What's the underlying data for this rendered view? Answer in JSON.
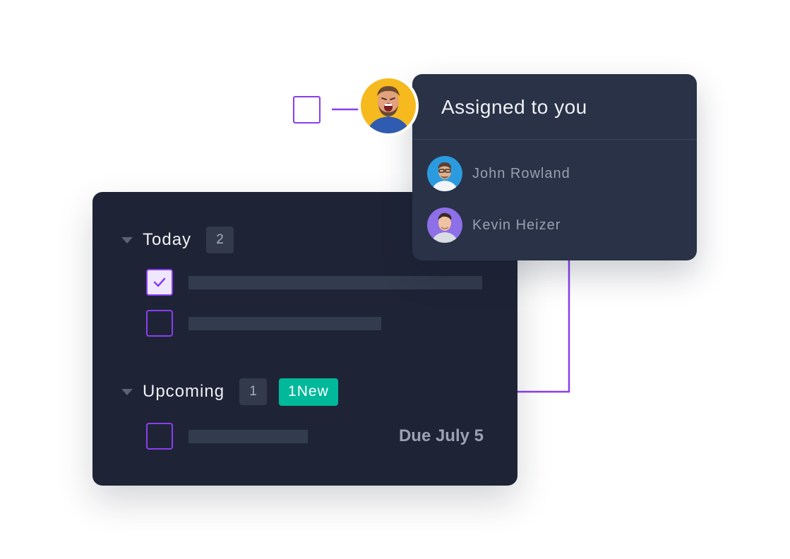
{
  "colors": {
    "accent": "#8a3df0",
    "panel_bg": "#1e2436",
    "popup_bg": "#293246",
    "new_badge": "#00b89a"
  },
  "popup": {
    "title": "Assigned to you",
    "assignees": [
      {
        "name": "John Rowland",
        "icon": "avatar-john"
      },
      {
        "name": "Kevin Heizer",
        "icon": "avatar-kevin"
      }
    ]
  },
  "tasks": {
    "today": {
      "label": "Today",
      "count": "2",
      "items": [
        {
          "checked": true
        },
        {
          "checked": false
        }
      ]
    },
    "upcoming": {
      "label": "Upcoming",
      "count": "1",
      "new_badge": "1New",
      "items": [
        {
          "checked": false,
          "due": "Due July 5"
        }
      ]
    }
  }
}
